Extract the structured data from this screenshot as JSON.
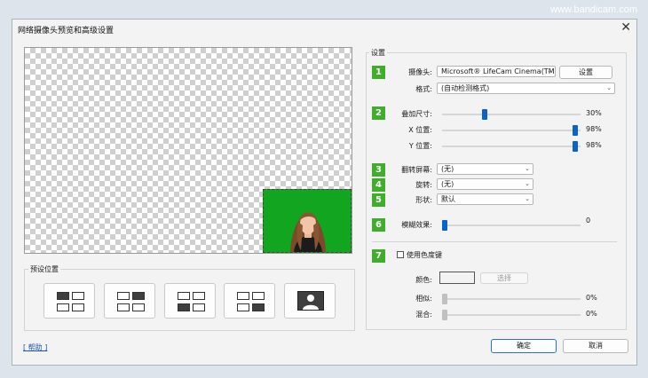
{
  "watermark": "www.bandicam.com",
  "window": {
    "title": "网络摄像头预览和高级设置",
    "close_glyph": "✕"
  },
  "preset_group": {
    "label": "预设位置"
  },
  "settings_group": {
    "label": "设置"
  },
  "steps": [
    "1",
    "2",
    "3",
    "4",
    "5",
    "6",
    "7"
  ],
  "camera": {
    "label": "摄像头:",
    "value": "Microsoft® LifeCam Cinema(TM)",
    "settings_button": "设置"
  },
  "format": {
    "label": "格式:",
    "value": "(自动检测格式)"
  },
  "overlay_size": {
    "label": "叠加尺寸:",
    "value_text": "30%",
    "level": 0.3
  },
  "x_pos": {
    "label": "X 位置:",
    "value_text": "98%",
    "level": 0.98
  },
  "y_pos": {
    "label": "Y 位置:",
    "value_text": "98%",
    "level": 0.98
  },
  "flip": {
    "label": "翻转屏幕:",
    "value": "(无)"
  },
  "rotate": {
    "label": "旋转:",
    "value": "(无)"
  },
  "shape": {
    "label": "形状:",
    "value": "默认"
  },
  "blur": {
    "label": "模糊效果:",
    "value_text": "0",
    "level": 0
  },
  "chroma": {
    "checkbox_label": "使用色度键",
    "checked": false,
    "color_label": "颜色:",
    "choose_button": "选择",
    "similarity": {
      "label": "相似:",
      "value_text": "0%",
      "level": 0
    },
    "blend": {
      "label": "混合:",
      "value_text": "0%",
      "level": 0
    }
  },
  "footer": {
    "help": "[ 帮助 ]",
    "ok": "确定",
    "cancel": "取消"
  },
  "icons": {
    "dropdown": "chevron-down-icon",
    "close": "close-icon"
  },
  "colors": {
    "accent": "#0a63c9",
    "badge": "#3fae2a",
    "chroma_bg": "#12a51f"
  }
}
